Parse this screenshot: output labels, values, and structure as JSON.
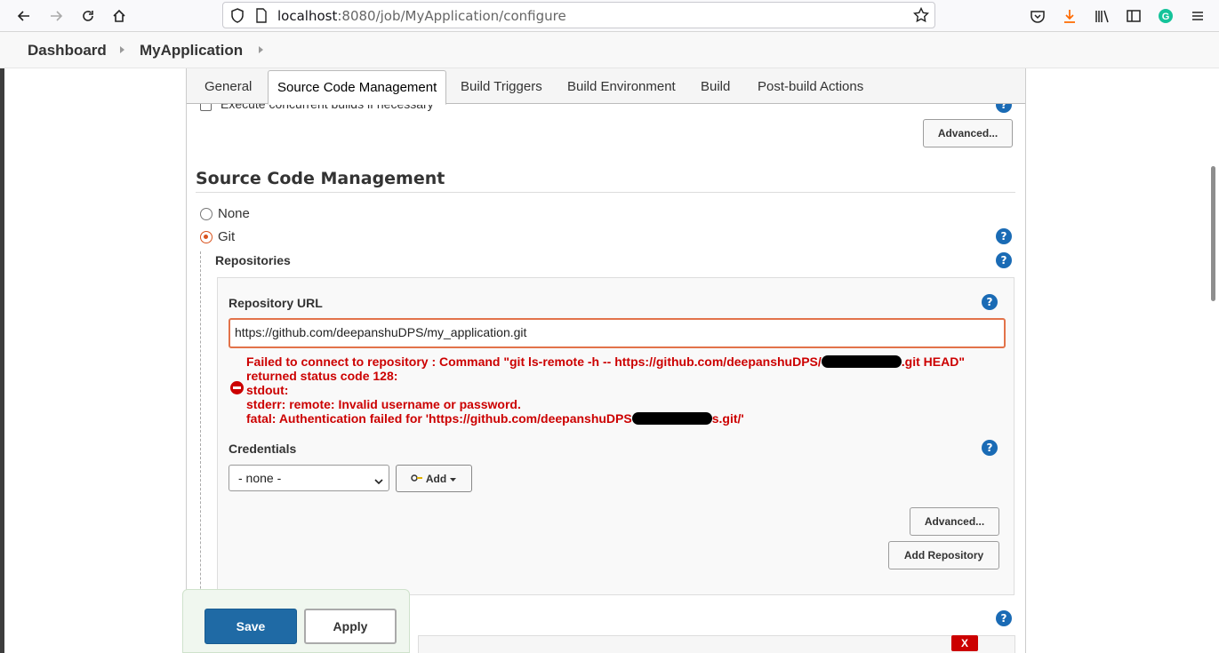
{
  "browser": {
    "url_host": "localhost",
    "url_rest": ":8080/job/MyApplication/configure",
    "icons": [
      "back-icon",
      "forward-icon",
      "reload-icon",
      "home-icon",
      "shield-icon",
      "page-icon",
      "bookmark-star-icon",
      "pocket-icon",
      "download-icon",
      "library-icon",
      "sidebar-icon",
      "grammarly-icon",
      "menu-icon"
    ],
    "accent": "#ff6a00"
  },
  "breadcrumb": {
    "items": [
      "Dashboard",
      "MyApplication"
    ]
  },
  "tabs": [
    "General",
    "Source Code Management",
    "Build Triggers",
    "Build Environment",
    "Build",
    "Post-build Actions"
  ],
  "active_tab": "Source Code Management",
  "general": {
    "concurrent_label": "Execute concurrent builds if necessary",
    "advanced_label": "Advanced..."
  },
  "scm": {
    "title": "Source Code Management",
    "options": [
      "None",
      "Git"
    ],
    "selected": "Git",
    "repositories_label": "Repositories",
    "repo_url_label": "Repository URL",
    "repo_url_value": "https://github.com/deepanshuDPS/my_application.git",
    "error": {
      "line1_a": "Failed to connect to repository : Command \"git ls-remote -h -- https://github.com/deepanshuDPS/",
      "line1_b": ".git HEAD\"",
      "line2": "returned status code 128:",
      "line3": "stdout:",
      "line4": "stderr: remote: Invalid username or password.",
      "line5_a": "fatal: Authentication failed for 'https://github.com/deepanshuDPS",
      "line5_b": "s.git/'",
      "color": "#cc0000"
    },
    "credentials_label": "Credentials",
    "credentials_selected": "- none -",
    "add_label": "Add",
    "advanced_label": "Advanced...",
    "add_repository_label": "Add Repository",
    "delete_label": "X"
  },
  "footer": {
    "save_label": "Save",
    "apply_label": "Apply",
    "save_color": "#1f6aa5"
  }
}
